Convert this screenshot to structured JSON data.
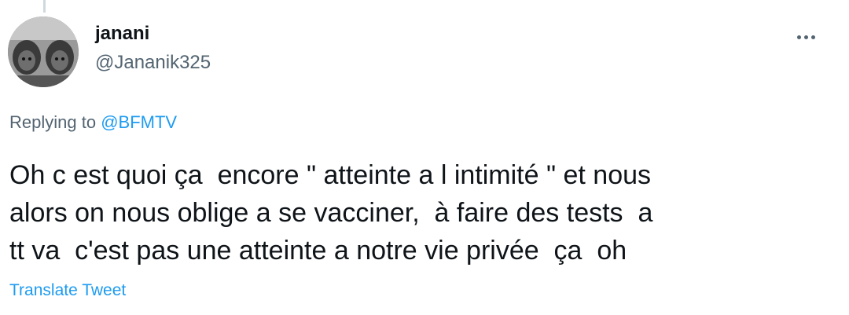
{
  "author": {
    "name": "janani",
    "handle": "@Jananik325"
  },
  "more_icon": "more-horizontal-icon",
  "reply": {
    "prefix": "Replying to ",
    "mention": "@BFMTV"
  },
  "tweet": {
    "lines": [
      "Oh c est quoi ça  encore \" atteinte a l intimité \" et nous",
      "alors on nous oblige a se vacciner,  à faire des tests  a",
      "tt va  c'est pas une atteinte a notre vie privée  ça  oh"
    ]
  },
  "translate_label": "Translate Tweet",
  "colors": {
    "text": "#0f1419",
    "secondary": "#536471",
    "accent": "#1d9bf0"
  }
}
